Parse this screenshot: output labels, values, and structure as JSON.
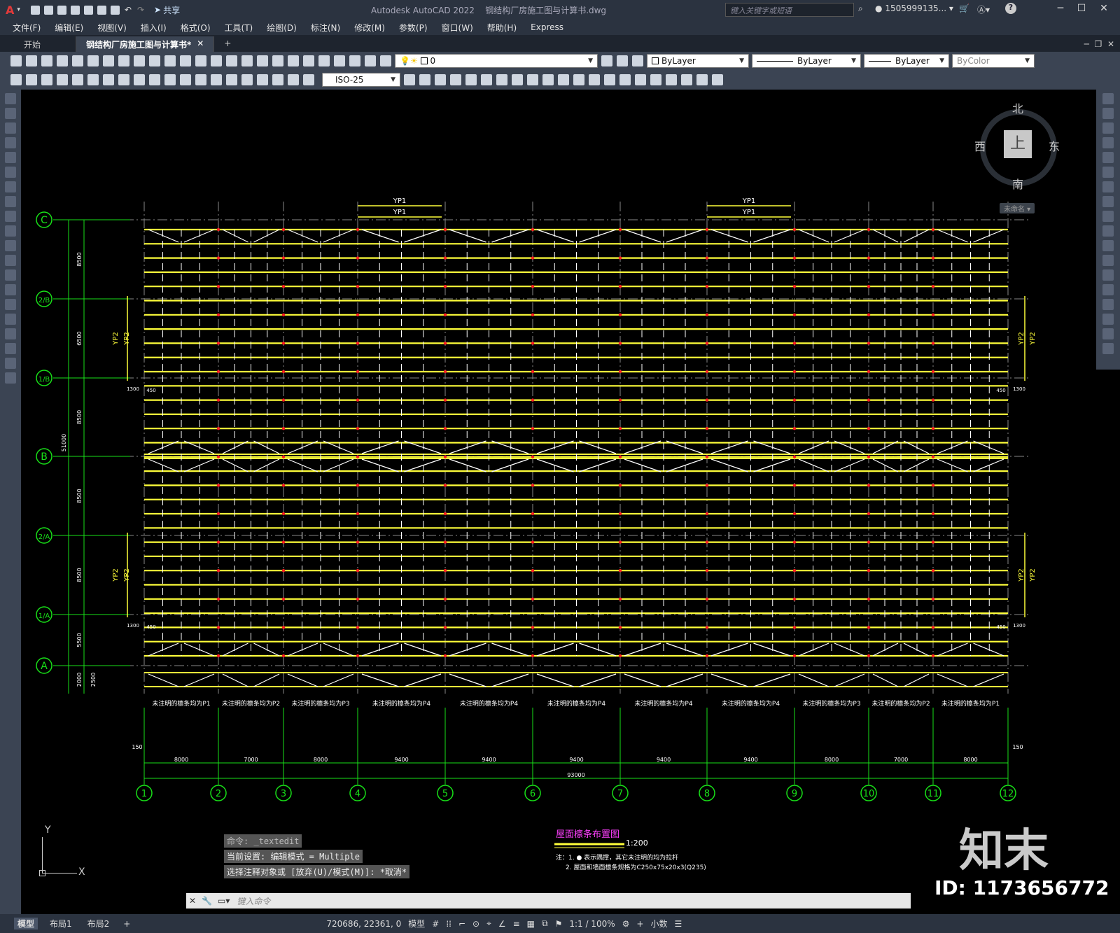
{
  "app": {
    "title": "Autodesk AutoCAD 2022",
    "filename": "钢结构厂房施工图与计算书.dwg",
    "share_label": "共享",
    "search_placeholder": "键入关键字或短语",
    "user": "1505999135...",
    "window_controls": [
      "minimize-icon",
      "restore-icon",
      "close-icon"
    ]
  },
  "menu": [
    "文件(F)",
    "编辑(E)",
    "视图(V)",
    "插入(I)",
    "格式(O)",
    "工具(T)",
    "绘图(D)",
    "标注(N)",
    "修改(M)",
    "参数(P)",
    "窗口(W)",
    "帮助(H)",
    "Express"
  ],
  "tabs": {
    "start": "开始",
    "doc": "钢结构厂房施工图与计算书*",
    "add": "+"
  },
  "toolbar": {
    "layer_value": "0",
    "color": "ByLayer",
    "linetype": "ByLayer",
    "lineweight": "ByLayer",
    "plotstyle": "ByColor",
    "dimstyle": "ISO-25"
  },
  "viewcube": {
    "north": "北",
    "south": "南",
    "east": "东",
    "west": "西",
    "face": "上",
    "ucs_name": "未命名"
  },
  "drawing": {
    "grid_rows": [
      "C",
      "2/B",
      "1/B",
      "B",
      "2/A",
      "1/A",
      "A"
    ],
    "grid_cols": [
      "1",
      "2",
      "3",
      "4",
      "5",
      "6",
      "7",
      "8",
      "9",
      "10",
      "11",
      "12"
    ],
    "row_dims": [
      "8500",
      "6500",
      "8500",
      "8500",
      "8500",
      "5500",
      "2000"
    ],
    "total_row_dim": "51000",
    "small_dim_2500": "2500",
    "col_dims": [
      "8000",
      "7000",
      "8000",
      "9400",
      "9400",
      "9400",
      "9400",
      "9400",
      "8000",
      "7000",
      "8000"
    ],
    "total_col_dim": "93000",
    "edge_150": "150",
    "yp1": "YP1",
    "yp2": "YP2",
    "dim_1300": "1300",
    "dim_450": "450",
    "purlin_notes": [
      "未注明的檩条均为P1",
      "未注明的檩条均为P2",
      "未注明的檩条均为P3",
      "未注明的檩条均为P4",
      "未注明的檩条均为P4",
      "未注明的檩条均为P4",
      "未注明的檩条均为P4",
      "未注明的檩条均为P4",
      "未注明的檩条均为P3",
      "未注明的檩条均为P2",
      "未注明的檩条均为P1"
    ],
    "drawing_title": "屋面檩条布置图",
    "scale": "1:200",
    "note1": "注：1. ● 表示隅撑，其它未注明的均为拉杆",
    "note2": "2. 屋面和墙面檩条规格为C250x75x20x3(Q235)"
  },
  "command": {
    "history": [
      "命令: _textedit",
      "当前设置: 编辑模式 = Multiple",
      "选择注释对象或 [放弃(U)/模式(M)]: *取消*"
    ],
    "prompt_placeholder": "键入命令"
  },
  "layout_tabs": [
    "模型",
    "布局1",
    "布局2"
  ],
  "status": {
    "coords": "720686, 22361, 0",
    "mode": "模型",
    "scale": "1:1 / 100%",
    "units": "小数"
  },
  "watermark": {
    "logo": "知末",
    "id": "ID: 1173656772"
  },
  "colors": {
    "grid_green": "#18e018",
    "purlin_yellow": "#ffff3a",
    "brace_white": "#ffffff",
    "bolt_red": "#ff2020",
    "title_magenta": "#ff40ff"
  }
}
